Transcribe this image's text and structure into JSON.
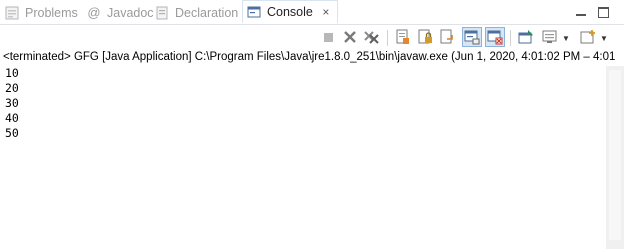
{
  "tabs": [
    {
      "label": "Problems",
      "icon": "problems-icon",
      "active": false
    },
    {
      "label": "Javadoc",
      "icon": "at-sign-icon",
      "active": false
    },
    {
      "label": "Declaration",
      "icon": "declaration-icon",
      "active": false
    },
    {
      "label": "Console",
      "icon": "console-icon",
      "active": true
    }
  ],
  "tab_close_glyph": "×",
  "at_glyph": "@",
  "status": "<terminated> GFG [Java Application] C:\\Program Files\\Java\\jre1.8.0_251\\bin\\javaw.exe  (Jun 1, 2020, 4:01:02 PM – 4:01",
  "output": [
    "10",
    "20",
    "30",
    "40",
    "50"
  ],
  "colors": {
    "accent": "#3a7bd5",
    "toggled_bg": "#d7e6f5"
  }
}
